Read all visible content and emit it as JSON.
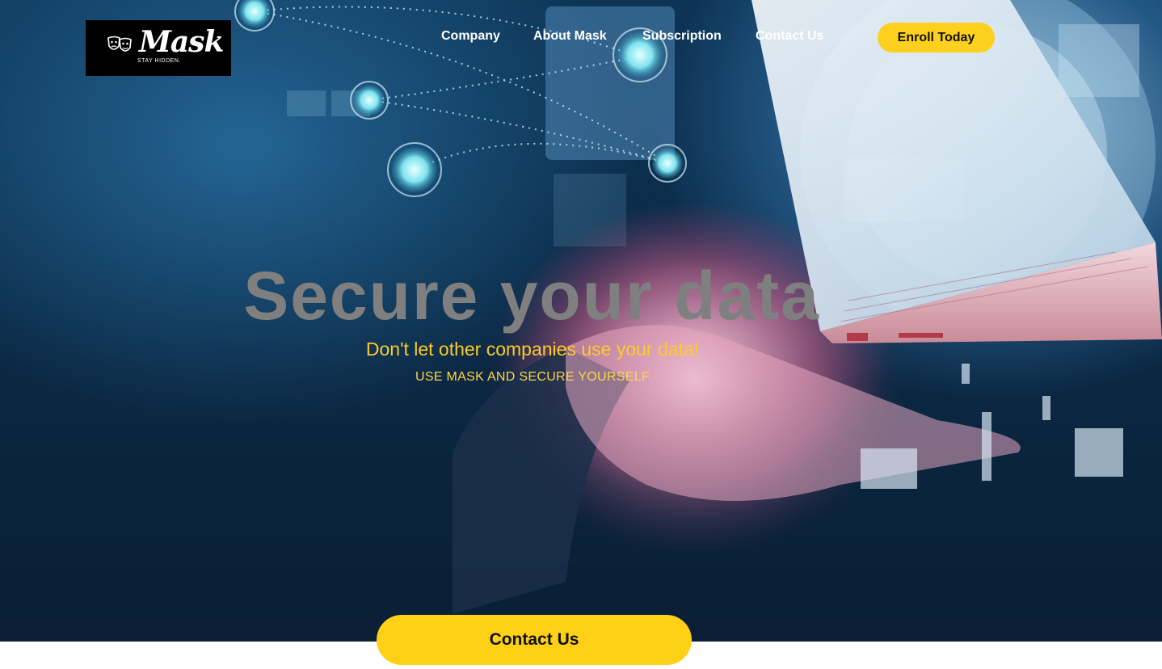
{
  "logo": {
    "name": "Mask",
    "tagline": "STAY HIDDEN."
  },
  "nav": {
    "items": [
      {
        "label": "Company"
      },
      {
        "label": "About Mask"
      },
      {
        "label": "Subscription"
      },
      {
        "label": "Contact Us"
      }
    ],
    "cta_label": "Enroll Today"
  },
  "hero": {
    "title": "Secure your data",
    "subtitle": "Don't let other companies use your data!",
    "tagline": "USE MASK AND SECURE YOURSELF"
  },
  "contact_button_label": "Contact Us",
  "colors": {
    "accent": "#fdd01d",
    "headline": "#7f7f80",
    "subtitle": "#ffca28"
  },
  "icons": {
    "logo": "theater-masks-icon"
  }
}
